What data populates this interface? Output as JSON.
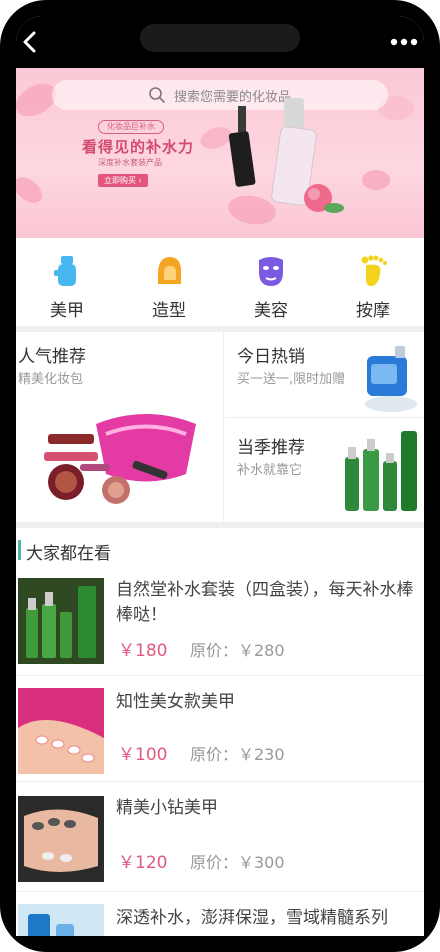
{
  "search": {
    "placeholder": "搜索您需要的化妆品"
  },
  "banner": {
    "tag": "化妆品巨补水",
    "title": "看得见的补水力",
    "subtitle": "深度补水套装产品",
    "cta": "立即购买 ›"
  },
  "categories": [
    {
      "label": "美甲",
      "icon": "nail-icon",
      "color": "#48b7f0"
    },
    {
      "label": "造型",
      "icon": "hairstyle-icon",
      "color": "#f4a623"
    },
    {
      "label": "美容",
      "icon": "face-mask-icon",
      "color": "#7a5ae0"
    },
    {
      "label": "按摩",
      "icon": "foot-massage-icon",
      "color": "#f5d21c"
    }
  ],
  "promo": {
    "left": {
      "title": "人气推荐",
      "subtitle": "精美化妆包"
    },
    "right_top": {
      "title": "今日热销",
      "subtitle": "买一送一,限时加赠"
    },
    "right_bottom": {
      "title": "当季推荐",
      "subtitle": "补水就靠它"
    }
  },
  "section": {
    "title": "大家都在看"
  },
  "products": [
    {
      "name": "自然堂补水套装（四盒装），每天补水棒棒哒！",
      "price": "￥180",
      "original": "原价：￥280"
    },
    {
      "name": "知性美女款美甲",
      "price": "￥100",
      "original": "原价：￥230"
    },
    {
      "name": "精美小钻美甲",
      "price": "￥120",
      "original": "原价：￥300"
    },
    {
      "name": "深透补水，澎湃保湿，雪域精髓系列",
      "price": "",
      "original": ""
    }
  ],
  "colors": {
    "accent": "#e05b7f",
    "section_bar": "#4bb3a7"
  }
}
